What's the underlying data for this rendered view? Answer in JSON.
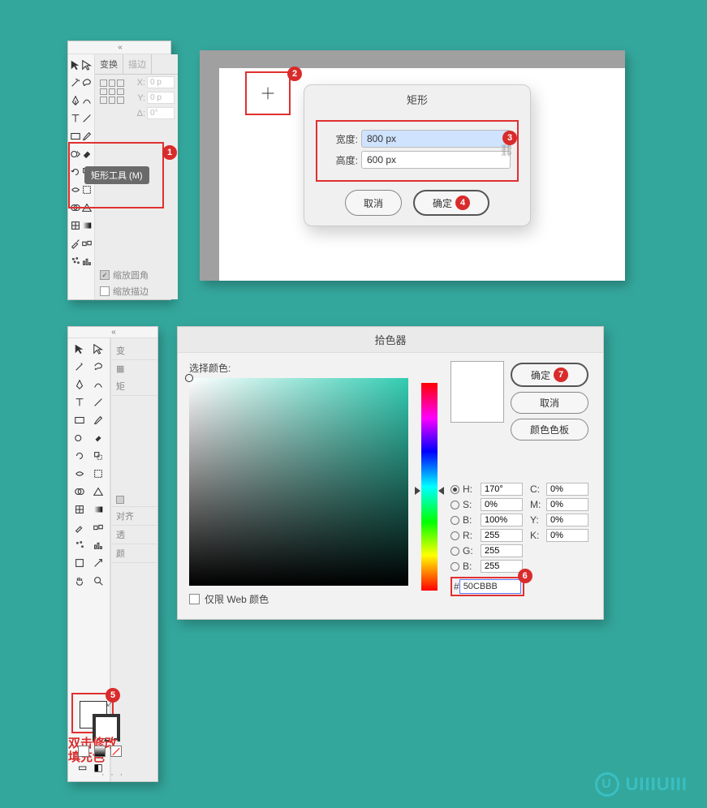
{
  "panel1": {
    "tabs": {
      "transform": "变换",
      "stroke": "描边"
    },
    "transform": {
      "x_label": "X:",
      "x_value": "0 p",
      "y_label": "Y:",
      "y_value": "0 p",
      "angle_label": "Δ:",
      "angle_value": "0°"
    },
    "checks": {
      "scale_corners": "缩放圆角",
      "scale_stroke": "缩放描边"
    },
    "tooltip": "矩形工具 (M)"
  },
  "rect_dialog": {
    "title": "矩形",
    "width_label": "宽度:",
    "width_value": "800 px",
    "height_label": "高度:",
    "height_value": "600 px",
    "cancel": "取消",
    "ok": "确定"
  },
  "panel2": {
    "side_labels": {
      "transform_short": "变",
      "rect_short": "矩",
      "align_short": "对齐",
      "transparent_short": "透",
      "color_short": "颜"
    },
    "swatch_caption_l1": "双击修改",
    "swatch_caption_l2": "填充色"
  },
  "color_picker": {
    "title": "拾色器",
    "select_label": "选择颜色:",
    "web_only": "仅限 Web 颜色",
    "buttons": {
      "ok": "确定",
      "cancel": "取消",
      "swatches": "颜色色板"
    },
    "hsb": {
      "h_label": "H:",
      "h_value": "170°",
      "s_label": "S:",
      "s_value": "0%",
      "b_label": "B:",
      "b_value": "100%"
    },
    "rgb": {
      "r_label": "R:",
      "r_value": "255",
      "g_label": "G:",
      "g_value": "255",
      "b_label": "B:",
      "b_value": "255"
    },
    "cmyk": {
      "c_label": "C:",
      "c_value": "0%",
      "m_label": "M:",
      "m_value": "0%",
      "y_label": "Y:",
      "y_value": "0%",
      "k_label": "K:",
      "k_value": "0%"
    },
    "hex_label": "#",
    "hex_value": "50CBBB"
  },
  "badges": {
    "b1": "1",
    "b2": "2",
    "b3": "3",
    "b4": "4",
    "b5": "5",
    "b6": "6",
    "b7": "7"
  },
  "watermark": "UIIIUIII"
}
